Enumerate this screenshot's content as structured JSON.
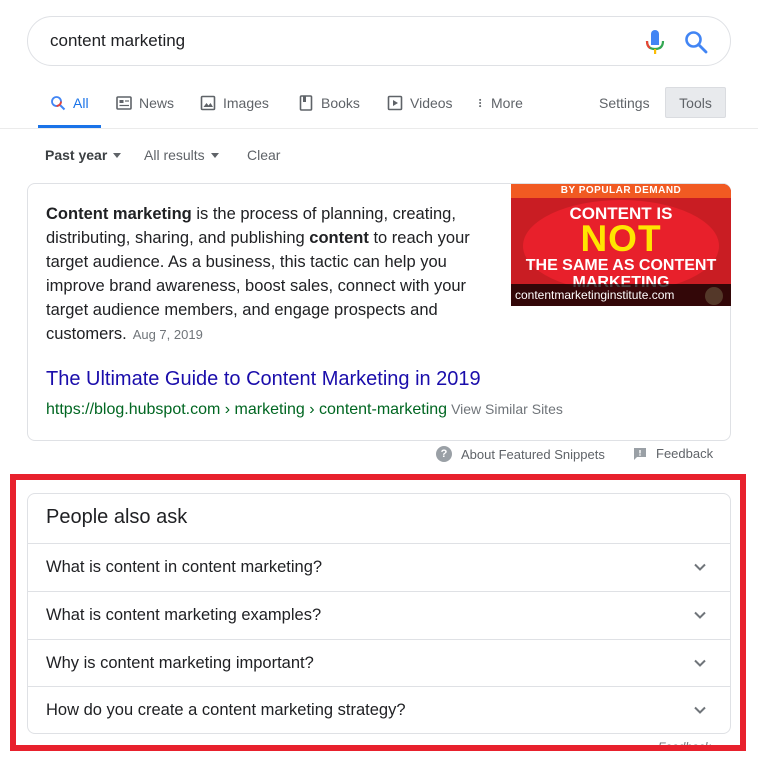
{
  "search": {
    "query": "content marketing"
  },
  "tabs": [
    {
      "label": "All",
      "icon": "search-icon"
    },
    {
      "label": "News",
      "icon": "news-icon"
    },
    {
      "label": "Images",
      "icon": "image-icon"
    },
    {
      "label": "Books",
      "icon": "book-icon"
    },
    {
      "label": "Videos",
      "icon": "video-icon"
    },
    {
      "label": "More",
      "icon": "more-vert-icon"
    }
  ],
  "settings_label": "Settings",
  "tools_label": "Tools",
  "filters": {
    "time": "Past year",
    "results": "All results",
    "clear": "Clear"
  },
  "snippet": {
    "bold1": "Content marketing",
    "text1": " is the process of planning, creating, distributing, sharing, and publishing ",
    "bold2": "content",
    "text2": " to reach your target audience. As a business, this tactic can help you improve brand awareness, boost sales, connect with your target audience members, and engage prospects and customers.",
    "date": "Aug 7, 2019",
    "image": {
      "banner": "BY POPULAR DEMAND",
      "line1": "CONTENT IS",
      "line2": "NOT",
      "line3": "THE SAME AS CONTENT",
      "line4": "MARKETING",
      "source": "contentmarketinginstitute.com"
    },
    "title": "The Ultimate Guide to Content Marketing in 2019",
    "url": "https://blog.hubspot.com › marketing › content-marketing",
    "similar": "View Similar Sites"
  },
  "about_snippets": "About Featured Snippets",
  "feedback": "Feedback",
  "paa": {
    "title": "People also ask",
    "questions": [
      "What is content in content marketing?",
      "What is content marketing examples?",
      "Why is content marketing important?",
      "How do you create a content marketing strategy?"
    ],
    "feedback": "Feedback"
  },
  "colors": {
    "accent": "#1a73e8",
    "link": "#1a0dab",
    "url": "#006621",
    "annotation": "#e8212d"
  }
}
